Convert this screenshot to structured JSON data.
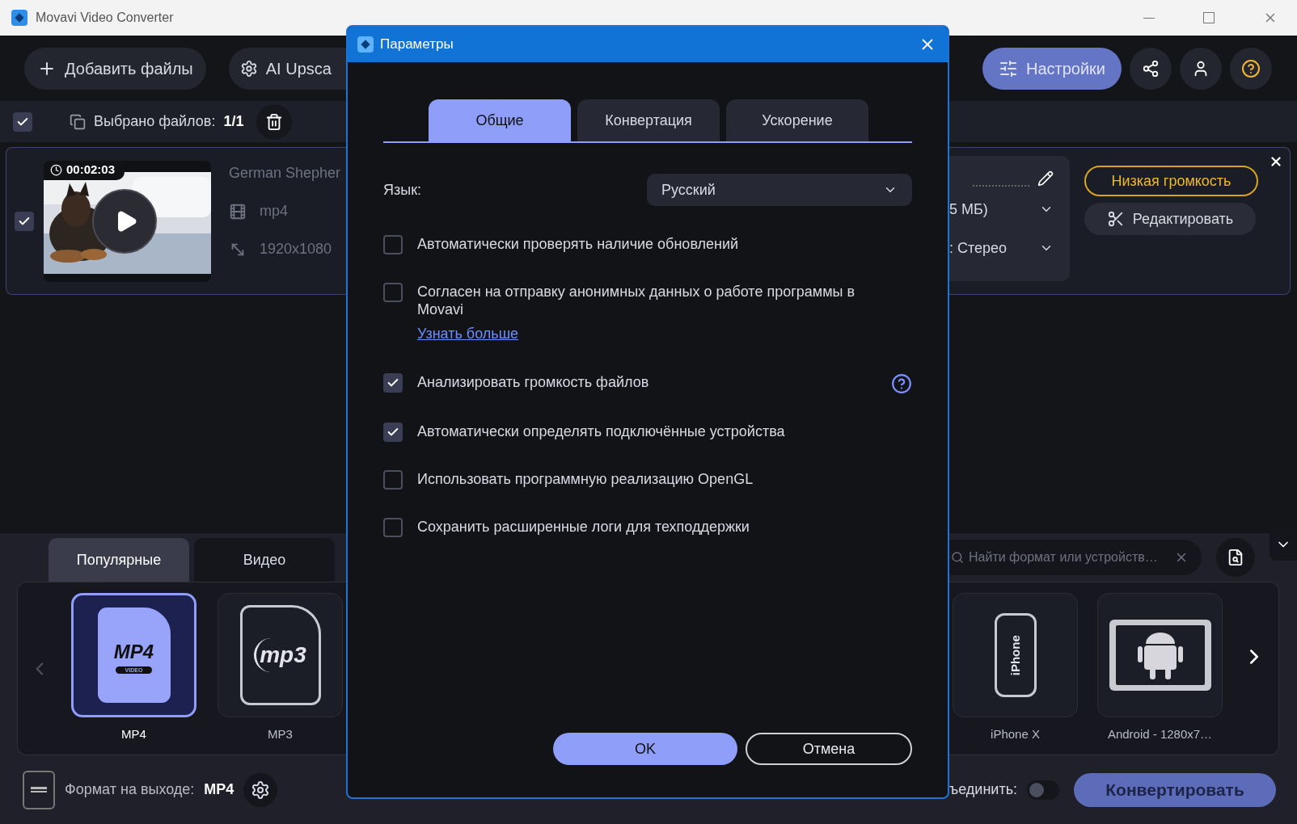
{
  "window": {
    "title": "Movavi Video Converter"
  },
  "toolbar": {
    "add_files": "Добавить файлы",
    "ai_upscale": "AI Upsca",
    "settings": "Настройки"
  },
  "selection_bar": {
    "checked": true,
    "label": "Выбрано файлов:",
    "count": "1/1"
  },
  "file": {
    "checked": true,
    "duration": "00:02:03",
    "name": "German Shepher",
    "format": "mp4",
    "resolution": "1920x1080",
    "size": "5 МБ)",
    "audio": ": Стерео",
    "badge": "Низкая громкость",
    "edit": "Редактировать"
  },
  "format_tabs": [
    {
      "label": "Популярные",
      "selected": true
    },
    {
      "label": "Видео",
      "selected": false
    }
  ],
  "search": {
    "placeholder": "Найти формат или устройств…"
  },
  "formats_left": [
    {
      "label": "MP4",
      "kind": "mp4",
      "icon_text": "MP4",
      "icon_subtext": "VIDEO",
      "selected": true
    },
    {
      "label": "MP3",
      "kind": "mp3",
      "icon_text": "mp3",
      "selected": false
    }
  ],
  "formats_right": [
    {
      "label": "iPhone X",
      "kind": "iphone",
      "icon_text": "iPhone",
      "selected": false
    },
    {
      "label": "Android - 1280x7…",
      "kind": "android",
      "selected": false
    }
  ],
  "output": {
    "label": "Формат на выходе:",
    "value": "MP4"
  },
  "merge": {
    "label": "ъединить:",
    "on": false
  },
  "convert": "Конвертировать",
  "dialog": {
    "title": "Параметры",
    "tabs": [
      {
        "label": "Общие",
        "selected": true
      },
      {
        "label": "Конвертация",
        "selected": false
      },
      {
        "label": "Ускорение",
        "selected": false
      }
    ],
    "language": {
      "label": "Язык:",
      "value": "Русский"
    },
    "options": [
      {
        "label": "Автоматически проверять наличие обновлений",
        "checked": false
      },
      {
        "label": "Согласен на отправку анонимных данных о работе программы в Movavi",
        "checked": false,
        "link": "Узнать больше"
      },
      {
        "label": "Анализировать громкость файлов",
        "checked": true,
        "help": true
      },
      {
        "label": "Автоматически определять подключённые устройства",
        "checked": true
      },
      {
        "label": "Использовать программную реализацию OpenGL",
        "checked": false
      },
      {
        "label": "Сохранить расширенные логи для техподдержки",
        "checked": false
      }
    ],
    "buttons": [
      {
        "label": "OK",
        "kind": "primary"
      },
      {
        "label": "Отмена",
        "kind": "secondary"
      }
    ]
  }
}
